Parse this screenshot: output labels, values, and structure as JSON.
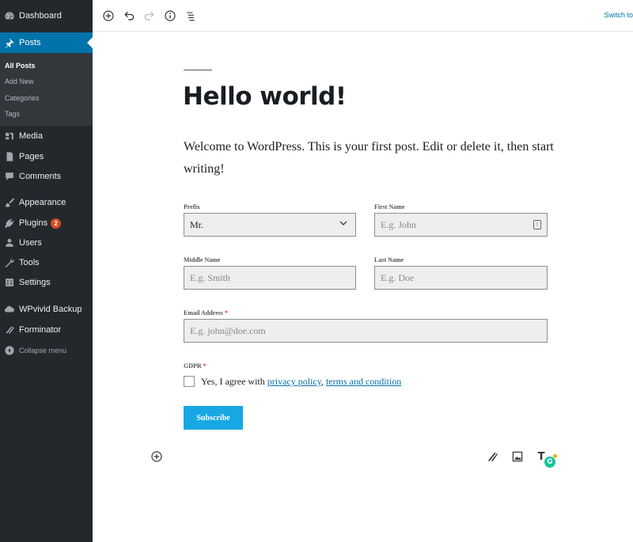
{
  "sidebar": {
    "dashboard": "Dashboard",
    "posts": "Posts",
    "posts_submenu": [
      "All Posts",
      "Add New",
      "Categories",
      "Tags"
    ],
    "media": "Media",
    "pages": "Pages",
    "comments": "Comments",
    "appearance": "Appearance",
    "plugins": "Plugins",
    "plugins_badge": "2",
    "users": "Users",
    "tools": "Tools",
    "settings": "Settings",
    "wpvivid": "WPvivid Backup",
    "forminator": "Forminator",
    "collapse": "Collapse menu"
  },
  "toolbar": {
    "switch_link": "Switch to"
  },
  "post": {
    "title": "Hello world!",
    "body": "Welcome to WordPress. This is your first post. Edit or delete it, then start writing!"
  },
  "form": {
    "prefix_label": "Prefix",
    "prefix_value": "Mr.",
    "first_name_label": "First Name",
    "first_name_placeholder": "E.g. John",
    "middle_name_label": "Middle Name",
    "middle_name_placeholder": "E.g. Smith",
    "last_name_label": "Last Name",
    "last_name_placeholder": "E.g. Doe",
    "email_label": "Email Address",
    "email_placeholder": "E.g. john@doe.com",
    "required_mark": "*",
    "gdpr_label": "GDPR",
    "gdpr_text_before": "Yes, I agree with ",
    "gdpr_link_privacy": "privacy policy",
    "gdpr_text_comma": ", ",
    "gdpr_link_terms": "terms and condition",
    "subscribe_label": "Subscribe"
  },
  "block_tools": {
    "grammarly_letter": "G",
    "text_tool_letter": "T"
  },
  "colors": {
    "sidebar_bg": "#23282d",
    "active_bg": "#0073aa",
    "accent_button": "#17a8e3",
    "badge": "#d54e21"
  }
}
